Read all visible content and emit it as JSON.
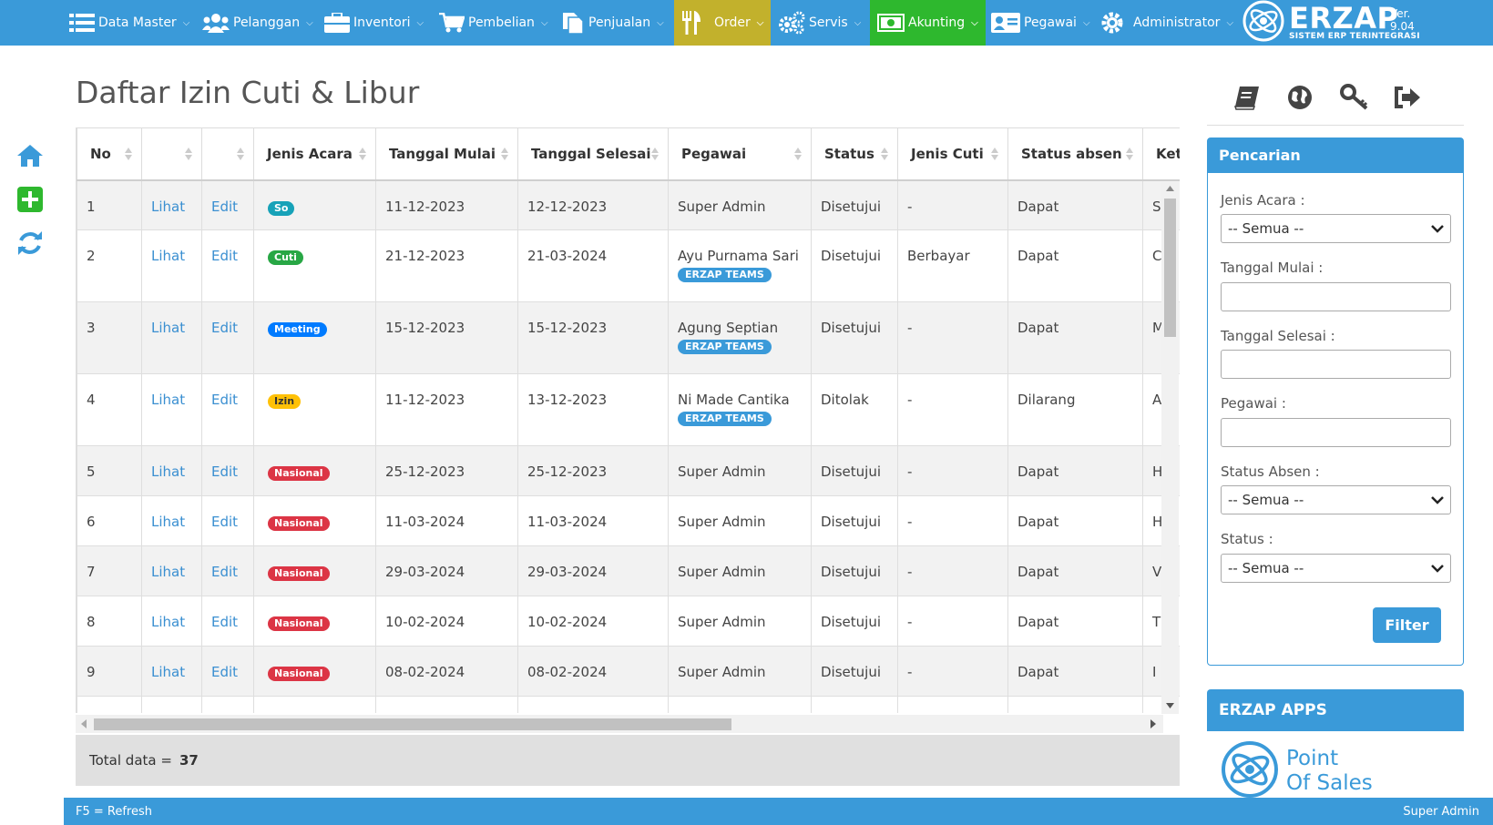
{
  "nav": {
    "items": [
      {
        "label": "Data Master"
      },
      {
        "label": "Pelanggan"
      },
      {
        "label": "Inventori"
      },
      {
        "label": "Pembelian"
      },
      {
        "label": "Penjualan"
      },
      {
        "label": "Order"
      },
      {
        "label": "Servis"
      },
      {
        "label": "Akunting"
      },
      {
        "label": "Pegawai"
      },
      {
        "label": "Administrator"
      }
    ],
    "brand_name": "ERZAP",
    "brand_tagline": "SISTEM ERP TERINTEGRASI",
    "version": "Ver. 9.04",
    "colors": {
      "bar": "#3a9ad9",
      "order": "#c2b12c",
      "akunting": "#2eb82e"
    }
  },
  "page": {
    "title": "Daftar Izin Cuti & Libur"
  },
  "table": {
    "headers": [
      "No",
      "",
      "",
      "Jenis Acara",
      "Tanggal Mulai",
      "Tanggal Selesai",
      "Pegawai",
      "Status",
      "Jenis Cuti",
      "Status absen",
      "Ket"
    ],
    "rows": [
      {
        "no": "1",
        "view": "Lihat",
        "edit": "Edit",
        "jenis": "So",
        "mulai": "11-12-2023",
        "selesai": "12-12-2023",
        "pegawai": "Super Admin",
        "team": "",
        "status": "Disetujui",
        "cuti": "-",
        "absen": "Dapat",
        "ket": "S"
      },
      {
        "no": "2",
        "view": "Lihat",
        "edit": "Edit",
        "jenis": "Cuti",
        "mulai": "21-12-2023",
        "selesai": "21-03-2024",
        "pegawai": "Ayu Purnama Sari",
        "team": "ERZAP TEAMS",
        "status": "Disetujui",
        "cuti": "Berbayar",
        "absen": "Dapat",
        "ket": "C"
      },
      {
        "no": "3",
        "view": "Lihat",
        "edit": "Edit",
        "jenis": "Meeting",
        "mulai": "15-12-2023",
        "selesai": "15-12-2023",
        "pegawai": "Agung Septian",
        "team": "ERZAP TEAMS",
        "status": "Disetujui",
        "cuti": "-",
        "absen": "Dapat",
        "ket": "M"
      },
      {
        "no": "4",
        "view": "Lihat",
        "edit": "Edit",
        "jenis": "Izin",
        "mulai": "11-12-2023",
        "selesai": "13-12-2023",
        "pegawai": "Ni Made Cantika",
        "team": "ERZAP TEAMS",
        "status": "Ditolak",
        "cuti": "-",
        "absen": "Dilarang",
        "ket": "A"
      },
      {
        "no": "5",
        "view": "Lihat",
        "edit": "Edit",
        "jenis": "Nasional",
        "mulai": "25-12-2023",
        "selesai": "25-12-2023",
        "pegawai": "Super Admin",
        "team": "",
        "status": "Disetujui",
        "cuti": "-",
        "absen": "Dapat",
        "ket": "H"
      },
      {
        "no": "6",
        "view": "Lihat",
        "edit": "Edit",
        "jenis": "Nasional",
        "mulai": "11-03-2024",
        "selesai": "11-03-2024",
        "pegawai": "Super Admin",
        "team": "",
        "status": "Disetujui",
        "cuti": "-",
        "absen": "Dapat",
        "ket": "H"
      },
      {
        "no": "7",
        "view": "Lihat",
        "edit": "Edit",
        "jenis": "Nasional",
        "mulai": "29-03-2024",
        "selesai": "29-03-2024",
        "pegawai": "Super Admin",
        "team": "",
        "status": "Disetujui",
        "cuti": "-",
        "absen": "Dapat",
        "ket": "V"
      },
      {
        "no": "8",
        "view": "Lihat",
        "edit": "Edit",
        "jenis": "Nasional",
        "mulai": "10-02-2024",
        "selesai": "10-02-2024",
        "pegawai": "Super Admin",
        "team": "",
        "status": "Disetujui",
        "cuti": "-",
        "absen": "Dapat",
        "ket": "T"
      },
      {
        "no": "9",
        "view": "Lihat",
        "edit": "Edit",
        "jenis": "Nasional",
        "mulai": "08-02-2024",
        "selesai": "08-02-2024",
        "pegawai": "Super Admin",
        "team": "",
        "status": "Disetujui",
        "cuti": "-",
        "absen": "Dapat",
        "ket": "I"
      }
    ],
    "badge_colors": {
      "So": "#17a2b8",
      "Cuti": "#28a745",
      "Meeting": "#007bff",
      "Izin": "#ffc107",
      "Nasional": "#dc3545"
    },
    "total_label": "Total data =",
    "total_value": "37"
  },
  "search": {
    "title": "Pencarian",
    "jenis_acara_label": "Jenis Acara :",
    "jenis_acara_value": "-- Semua --",
    "tanggal_mulai_label": "Tanggal Mulai :",
    "tanggal_selesai_label": "Tanggal Selesai :",
    "pegawai_label": "Pegawai :",
    "status_absen_label": "Status Absen :",
    "status_absen_value": "-- Semua --",
    "status_label": "Status :",
    "status_value": "-- Semua --",
    "filter_label": "Filter"
  },
  "apps": {
    "title": "ERZAP APPS",
    "pos_line1": "Point",
    "pos_line2": "Of Sales"
  },
  "footer": {
    "refresh_hint": "F5 = Refresh",
    "user": "Super Admin"
  }
}
